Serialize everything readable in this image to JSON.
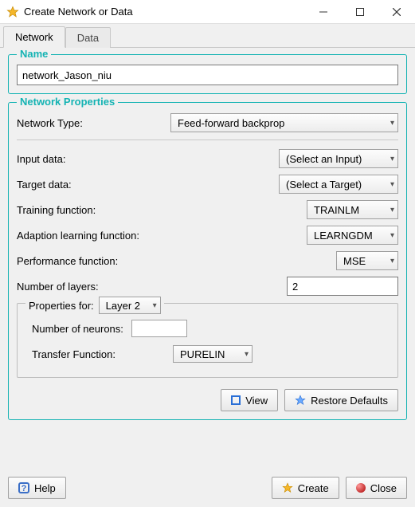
{
  "window": {
    "title": "Create Network or Data"
  },
  "tabs": {
    "network": "Network",
    "data": "Data"
  },
  "name_group": {
    "label": "Name",
    "value": "network_Jason_niu"
  },
  "props_group": {
    "label": "Network Properties",
    "network_type_label": "Network Type:",
    "network_type_value": "Feed-forward backprop",
    "input_data_label": "Input data:",
    "input_data_value": "(Select an Input)",
    "target_data_label": "Target data:",
    "target_data_value": "(Select a Target)",
    "training_fn_label": "Training function:",
    "training_fn_value": "TRAINLM",
    "adaption_fn_label": "Adaption learning function:",
    "adaption_fn_value": "LEARNGDM",
    "perf_fn_label": "Performance function:",
    "perf_fn_value": "MSE",
    "num_layers_label": "Number of layers:",
    "num_layers_value": "2",
    "layer_group": {
      "prefix": "Properties for:",
      "layer_value": "Layer 2",
      "neurons_label": "Number of neurons:",
      "neurons_value": "",
      "transfer_label": "Transfer Function:",
      "transfer_value": "PURELIN"
    }
  },
  "buttons": {
    "view": "View",
    "restore": "Restore Defaults",
    "help": "Help",
    "create": "Create",
    "close": "Close"
  }
}
